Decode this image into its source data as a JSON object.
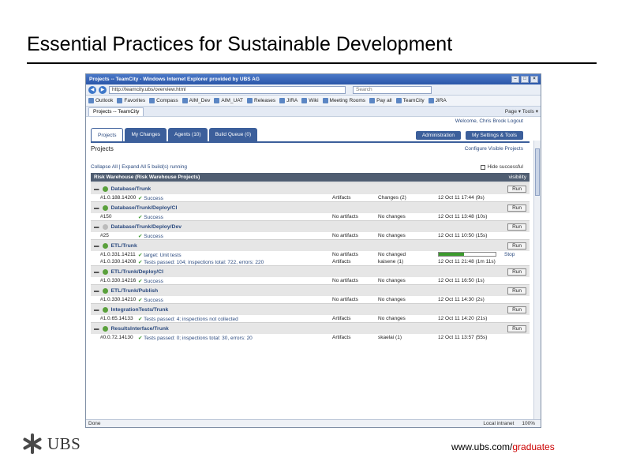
{
  "slide": {
    "title": "Essential Practices for Sustainable Development",
    "logo_text": "UBS",
    "footer_url_prefix": "www.ubs.com/",
    "footer_url_highlight": "graduates",
    "colors": {
      "rule": "#000000",
      "footer_highlight": "#cc0000"
    }
  },
  "browser": {
    "title": "Projects -- TeamCity - Windows Internet Explorer provided by UBS AG",
    "address": "http://teamcity.ubs/overview.html",
    "search_placeholder": "Search",
    "favorites": [
      "Outlook",
      "Favorites",
      "Compass",
      "AIM_Dev",
      "AIM_UAT",
      "Releases",
      "JIRA",
      "Wiki",
      "Meeting Rooms",
      "Pay all",
      "TeamCity",
      "JIRA"
    ],
    "tab_label": "Projects -- TeamCity",
    "tools_label": "Page ▾  Tools ▾",
    "status_left": "Done",
    "status_zone": "Local intranet",
    "status_zoom": "100%"
  },
  "teamcity": {
    "user": "Welcome, Chris Brook  Logout",
    "tabs": [
      "Projects",
      "My Changes",
      "Agents (10)",
      "Build Queue (0)"
    ],
    "actions": [
      "Administration",
      "My Settings & Tools"
    ],
    "heading": "Projects",
    "configure": "Configure Visible Projects",
    "collapse": "Collapse All | Expand All   5 build(s) running",
    "hide": "Hide successful",
    "group": "Risk Warehouse (Risk Warehouse Projects)",
    "group_visibility": "visibility",
    "run_label": "Run",
    "configs": [
      {
        "name": "Database/Trunk",
        "state": "ok",
        "builds": [
          {
            "num": "#1.0.188.14200",
            "status": "Success",
            "artifacts": "Artifacts",
            "changes": "Changes (2)",
            "date": "12 Oct 11 17:44 (9s)"
          }
        ]
      },
      {
        "name": "Database/Trunk/Deploy/CI",
        "state": "ok",
        "builds": [
          {
            "num": "#150",
            "status": "Success",
            "artifacts": "No artifacts",
            "changes": "No changes",
            "date": "12 Oct 11 13:48 (10s)"
          }
        ]
      },
      {
        "name": "Database/Trunk/Deploy/Dev",
        "state": "gray",
        "builds": [
          {
            "num": "#25",
            "status": "Success",
            "artifacts": "No artifacts",
            "changes": "No changes",
            "date": "12 Oct 11 10:50 (15s)"
          }
        ]
      },
      {
        "name": "ETL/Trunk",
        "state": "ok",
        "builds": [
          {
            "num": "#1.0.331.14211",
            "status": "target: Unit tests",
            "artifacts": "No artifacts",
            "changes": "No changed",
            "progress": 0.45,
            "stop": "Stop"
          },
          {
            "num": "#1.0.330.14208",
            "status": "Tests passed: 104; inspections total: 722, errors: 220",
            "artifacts": "Artifacts",
            "changes": "kaisene (1)",
            "date": "12 Oct 11 21:48 (1m 11s)"
          }
        ]
      },
      {
        "name": "ETL/Trunk/Deploy/CI",
        "state": "ok",
        "builds": [
          {
            "num": "#1.0.330.14216",
            "status": "Success",
            "artifacts": "No artifacts",
            "changes": "No changes",
            "date": "12 Oct 11 16:50 (1s)"
          }
        ]
      },
      {
        "name": "ETL/Trunk/Publish",
        "state": "ok",
        "builds": [
          {
            "num": "#1.0.330.14210",
            "status": "Success",
            "artifacts": "No artifacts",
            "changes": "No changes",
            "date": "12 Oct 11 14:30 (2s)"
          }
        ]
      },
      {
        "name": "IntegrationTests/Trunk",
        "state": "ok",
        "builds": [
          {
            "num": "#1.0.65.14133",
            "status": "Tests passed: 4; inspections not collected",
            "artifacts": "Artifacts",
            "changes": "No changes",
            "date": "12 Oct 11 14:20 (21s)"
          }
        ]
      },
      {
        "name": "ResultsInterface/Trunk",
        "state": "ok",
        "builds": [
          {
            "num": "#0.0.72.14130",
            "status": "Tests passed: 0; inspections total: 30, errors: 20",
            "artifacts": "Artifacts",
            "changes": "skaelai (1)",
            "date": "12 Oct 11 13:57 (55s)"
          }
        ]
      }
    ]
  }
}
